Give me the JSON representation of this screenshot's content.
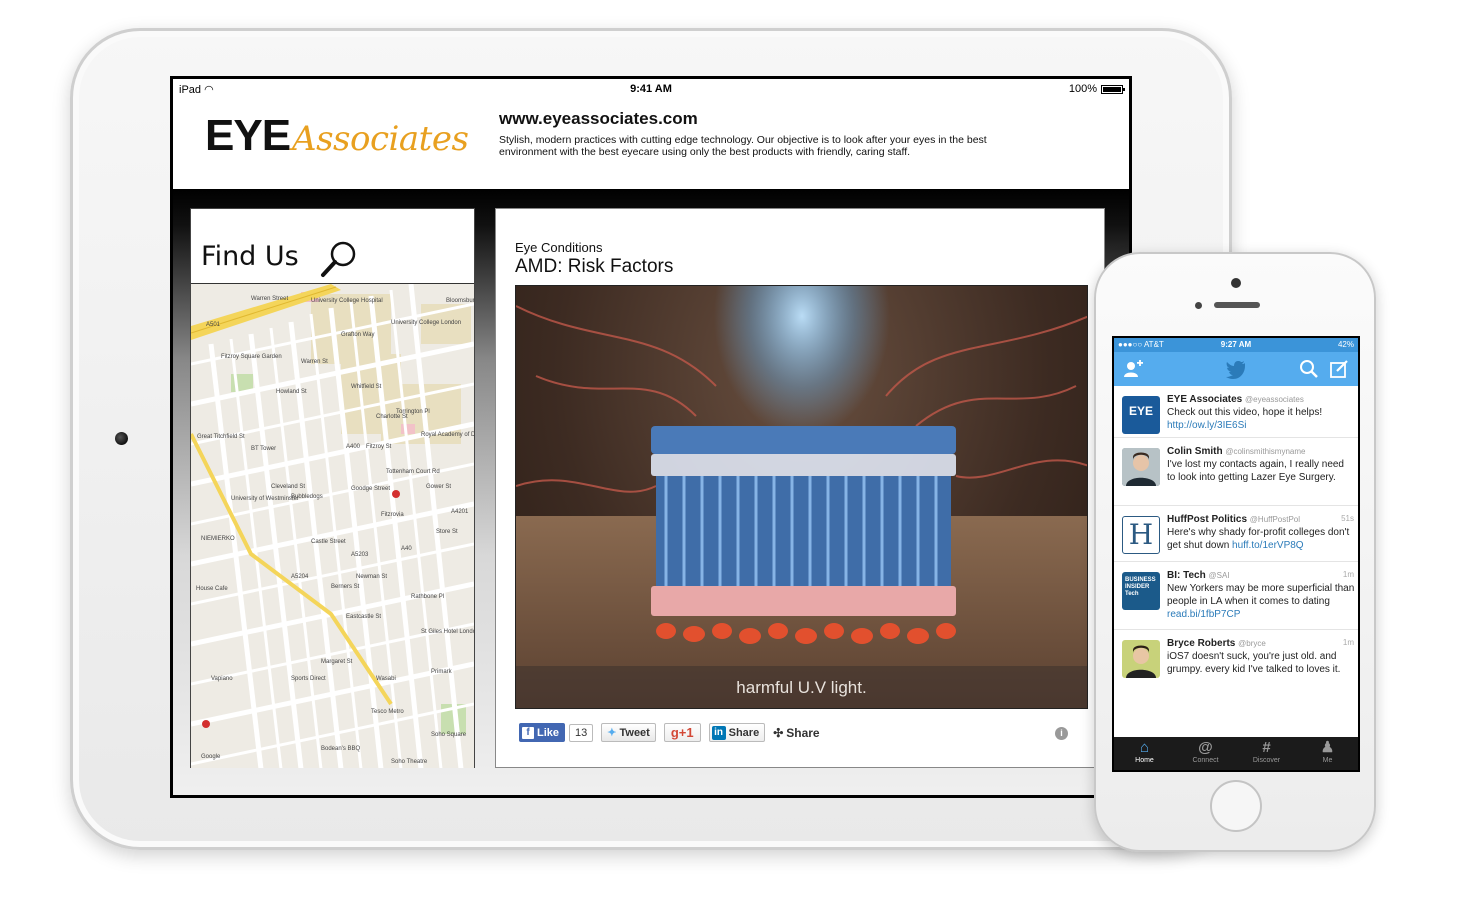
{
  "ipad": {
    "status": {
      "device": "iPad",
      "time": "9:41 AM",
      "battery": "100%"
    },
    "site": {
      "logo_eye": "EYE",
      "logo_associates": "Associates",
      "url": "www.eyeassociates.com",
      "description": "Stylish, modern practices with cutting edge technology. Our objective is to look after your eyes in the best environment with the best eyecare using only the best products with friendly, caring staff."
    },
    "find_us": {
      "title": "Find Us",
      "map_labels": [
        "Warren Street",
        "University College Hospital",
        "University College London",
        "Fitzroy Square Garden",
        "BT Tower",
        "University of Westminster",
        "Bubbledogs",
        "Goodge Street",
        "Fitzrovia",
        "NIEMIERKO",
        "House Cafe",
        "Royal Academy of Dramatic Art",
        "Sports Direct",
        "Wasabi",
        "Tesco Metro",
        "Soho Square",
        "Bodean's BBQ",
        "Soho Theatre",
        "St Giles Hotel London",
        "Primark",
        "Vapiano",
        "Bloomsbury",
        "Google",
        "A501",
        "A400",
        "A5204",
        "A5203",
        "A4201",
        "A40",
        "Castle Street",
        "Great Titchfield St",
        "Margaret St",
        "Eastcastle St",
        "Rathbone Pl",
        "Berners St",
        "Newman St",
        "Tottenham Court Rd",
        "Charlotte St",
        "Whitfield St",
        "Grafton Way",
        "Torrington Pl",
        "Gower St",
        "Store St",
        "Howland St",
        "Cleveland St",
        "Warren St",
        "Fitzroy St"
      ]
    },
    "article": {
      "category": "Eye Conditions",
      "title": "AMD: Risk Factors",
      "video_caption": "harmful U.V light.",
      "share": {
        "like": "Like",
        "like_count": "13",
        "tweet": "Tweet",
        "gplus": "g+1",
        "linkedin": "Share",
        "share": "Share"
      }
    }
  },
  "iphone": {
    "status": {
      "carrier": "●●●○○ AT&T",
      "time": "9:27 AM",
      "battery": "42%"
    },
    "tweets": [
      {
        "name": "EYE Associates",
        "handle": "@eyeassociates",
        "time": "",
        "text": "Check out this video, hope it helps!",
        "link": "http://ow.ly/3IE6Si",
        "avatar_text": "EYE"
      },
      {
        "name": "Colin Smith",
        "handle": "@colinsmithismyname",
        "time": "",
        "text": "I've lost my contacts again, I really need to look into getting Lazer Eye Surgery.",
        "link": "",
        "avatar_text": ""
      },
      {
        "name": "HuffPost Politics",
        "handle": "@HuffPostPol",
        "time": "51s",
        "text": "Here's why shady for-profit colleges don't get shut down",
        "link": "huff.to/1erVP8Q",
        "avatar_text": "H"
      },
      {
        "name": "BI: Tech",
        "handle": "@SAI",
        "time": "1m",
        "text": "New Yorkers may be more superficial than people in LA when it comes to dating",
        "link": "read.bi/1fbP7CP",
        "avatar_text": "BUSINESS INSIDER Tech"
      },
      {
        "name": "Bryce Roberts",
        "handle": "@bryce",
        "time": "1m",
        "text": "iOS7 doesn't suck, you're just old. and grumpy. every kid I've talked to loves it.",
        "link": "",
        "avatar_text": ""
      }
    ],
    "tabs": [
      {
        "icon": "⌂",
        "label": "Home"
      },
      {
        "icon": "@",
        "label": "Connect"
      },
      {
        "icon": "#",
        "label": "Discover"
      },
      {
        "icon": "♟",
        "label": "Me"
      }
    ]
  }
}
